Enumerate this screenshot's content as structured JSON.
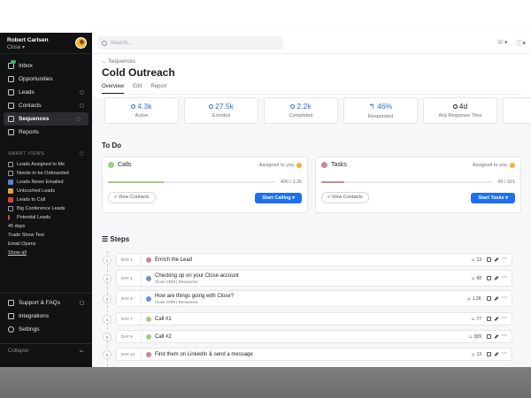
{
  "colors": {
    "sidebar_bg": "#111213",
    "accent": "#1f6ff2",
    "calls": "#9ed07d",
    "tasks": "#c48a93"
  },
  "sidebar": {
    "user_name": "Robert Carlsen",
    "org": "Close ▾",
    "nav": [
      {
        "label": "Inbox",
        "icon": "inbox-icon"
      },
      {
        "label": "Opportunities",
        "icon": "opportunities-icon"
      },
      {
        "label": "Leads",
        "icon": "leads-icon"
      },
      {
        "label": "Contacts",
        "icon": "contacts-icon"
      },
      {
        "label": "Sequences",
        "icon": "sequences-icon"
      },
      {
        "label": "Reports",
        "icon": "reports-icon"
      }
    ],
    "smart_views_heading": "SMART VIEWS",
    "smart_views": [
      "Leads Assigned to Me",
      "Needs to be Onboarded",
      "Leads Never Emailed",
      "Untouched Leads",
      "Leads to Call",
      "Big Conference Leads",
      "Potential Leads",
      "45 days",
      "Trade Show Test",
      "Email Opens"
    ],
    "show_all": "Show all",
    "bottom_nav": [
      {
        "label": "Support & FAQs",
        "icon": "support-icon"
      },
      {
        "label": "Integrations",
        "icon": "integrations-icon"
      },
      {
        "label": "Settings",
        "icon": "settings-icon"
      }
    ],
    "collapse": "Collapse"
  },
  "topbar": {
    "search_placeholder": "Search..."
  },
  "header": {
    "breadcrumb": "← Sequences",
    "title": "Cold Outreach",
    "tabs": [
      "Overview",
      "Edit",
      "Report"
    ]
  },
  "stats": [
    {
      "value": "4.3k",
      "label": "Active"
    },
    {
      "value": "27.5k",
      "label": "Enrolled"
    },
    {
      "value": "2.2k",
      "label": "Completed"
    },
    {
      "value": "46%",
      "label": "Responded"
    },
    {
      "value": "4d",
      "label": "Avg Response Time"
    }
  ],
  "todo": {
    "title": "To Do",
    "cards": [
      {
        "title": "Calls",
        "assigned": "Assigned to you",
        "progress_text": "400 / 1.2k",
        "progress": 0.333,
        "view": "View Contacts",
        "action": "Start Calling ▾"
      },
      {
        "title": "Tasks",
        "assigned": "Assigned to you",
        "progress_text": "43 / 321",
        "progress": 0.134,
        "view": "View Contacts",
        "action": "Start Tasks ▾"
      }
    ]
  },
  "steps": {
    "title": "Steps",
    "items": [
      {
        "num": "1",
        "day": "DAY 1",
        "label": "Enrich the Lead",
        "sub": "",
        "count": "13",
        "color": "#c48a93"
      },
      {
        "num": "2",
        "day": "DAY 1",
        "label": "Checking up on your Close account",
        "sub": "Close CRM | Resources",
        "count": "68",
        "color": "#6d93c9"
      },
      {
        "num": "3",
        "day": "DAY 3",
        "label": "How are things going with Close?",
        "sub": "Close CRM | Resources",
        "count": "1.2K",
        "color": "#6d93c9"
      },
      {
        "num": "4",
        "day": "DAY 7",
        "label": "Call #1",
        "sub": "",
        "count": "77",
        "color": "#9ed07d"
      },
      {
        "num": "5",
        "day": "DAY 9",
        "label": "Call #2",
        "sub": "",
        "count": "309",
        "color": "#9ed07d"
      },
      {
        "num": "6",
        "day": "DAY 12",
        "label": "Find them on LinkedIn & send a message",
        "sub": "",
        "count": "13",
        "color": "#c48a93"
      }
    ]
  }
}
